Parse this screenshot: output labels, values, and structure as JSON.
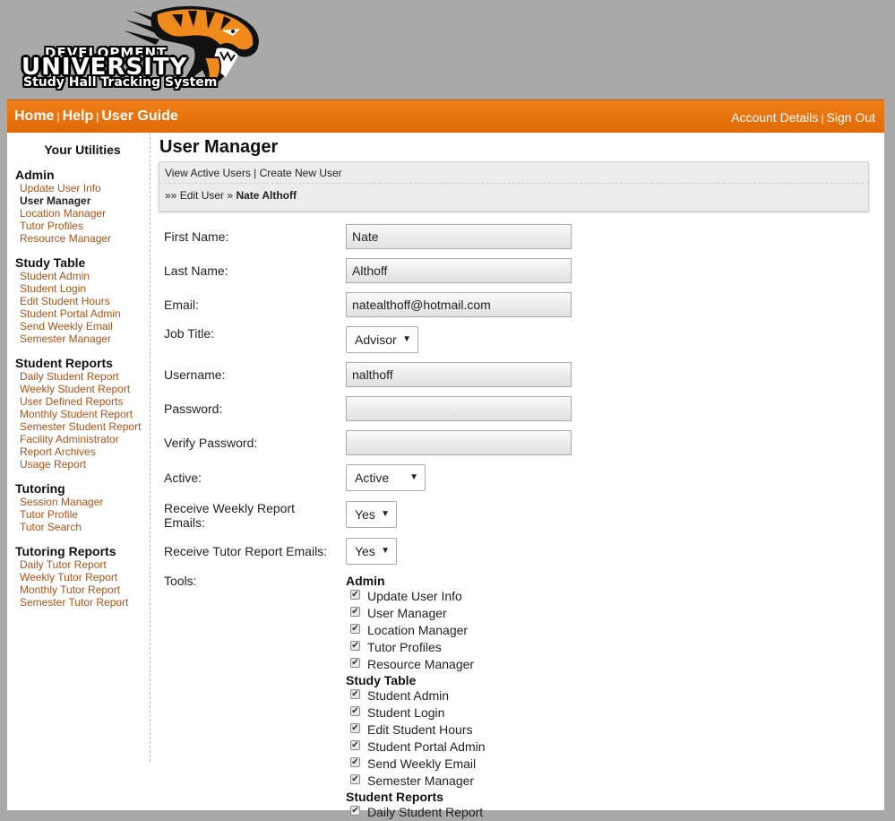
{
  "brand": {
    "line1": "DEVELOPMENT",
    "line2": "UNIVERSITY",
    "line3": "Study Hall Tracking System",
    "accent_color": "#e8740f"
  },
  "nav": {
    "home": "Home",
    "help": "Help",
    "user_guide": "User Guide",
    "account_details": "Account Details",
    "sign_out": "Sign Out",
    "separator": "|"
  },
  "sidebar": {
    "title": "Your Utilities",
    "groups": [
      {
        "heading": "Admin",
        "items": [
          "Update User Info",
          "User Manager",
          "Location Manager",
          "Tutor Profiles",
          "Resource Manager"
        ]
      },
      {
        "heading": "Study Table",
        "items": [
          "Student Admin",
          "Student Login",
          "Edit Student Hours",
          "Student Portal Admin",
          "Send Weekly Email",
          "Semester Manager"
        ]
      },
      {
        "heading": "Student Reports",
        "items": [
          "Daily Student Report",
          "Weekly Student Report",
          "User Defined Reports",
          "Monthly Student Report",
          "Semester Student Report",
          "Facility Administrator",
          "Report Archives",
          "Usage Report"
        ]
      },
      {
        "heading": "Tutoring",
        "items": [
          "Session Manager",
          "Tutor Profile",
          "Tutor Search"
        ]
      },
      {
        "heading": "Tutoring Reports",
        "items": [
          "Daily Tutor Report",
          "Weekly Tutor Report",
          "Monthly Tutor Report",
          "Semester Tutor Report"
        ]
      }
    ],
    "active_item": "User Manager"
  },
  "main": {
    "title": "User Manager",
    "subnav": {
      "view_active_users": "View Active Users",
      "separator": "|",
      "create_new_user": "Create New User",
      "crumb_prefix": "»»",
      "crumb_edit_user": "Edit User",
      "crumb_sep": "»",
      "crumb_current": "Nate Althoff"
    },
    "form": {
      "first_name_label": "First Name:",
      "first_name_value": "Nate",
      "last_name_label": "Last Name:",
      "last_name_value": "Althoff",
      "email_label": "Email:",
      "email_value": "natealthoff@hotmail.com",
      "job_title_label": "Job Title:",
      "job_title_value": "Advisor",
      "username_label": "Username:",
      "username_value": "nalthoff",
      "password_label": "Password:",
      "password_value": "",
      "verify_password_label": "Verify Password:",
      "verify_password_value": "",
      "active_label": "Active:",
      "active_value": "Active",
      "weekly_emails_label": "Receive Weekly Report Emails:",
      "weekly_emails_value": "Yes",
      "tutor_emails_label": "Receive Tutor Report Emails:",
      "tutor_emails_value": "Yes",
      "tools_label": "Tools:",
      "select_arrow": "▼"
    },
    "tools": [
      {
        "heading": "Admin",
        "items": [
          {
            "label": "Update User Info",
            "checked": true
          },
          {
            "label": "User Manager",
            "checked": true
          },
          {
            "label": "Location Manager",
            "checked": true
          },
          {
            "label": "Tutor Profiles",
            "checked": true
          },
          {
            "label": "Resource Manager",
            "checked": true
          }
        ]
      },
      {
        "heading": "Study Table",
        "items": [
          {
            "label": "Student Admin",
            "checked": true
          },
          {
            "label": "Student Login",
            "checked": true
          },
          {
            "label": "Edit Student Hours",
            "checked": true
          },
          {
            "label": "Student Portal Admin",
            "checked": true
          },
          {
            "label": "Send Weekly Email",
            "checked": true
          },
          {
            "label": "Semester Manager",
            "checked": true
          }
        ]
      },
      {
        "heading": "Student Reports",
        "items": [
          {
            "label": "Daily Student Report",
            "checked": true
          }
        ]
      }
    ],
    "checkmark": "✔"
  }
}
